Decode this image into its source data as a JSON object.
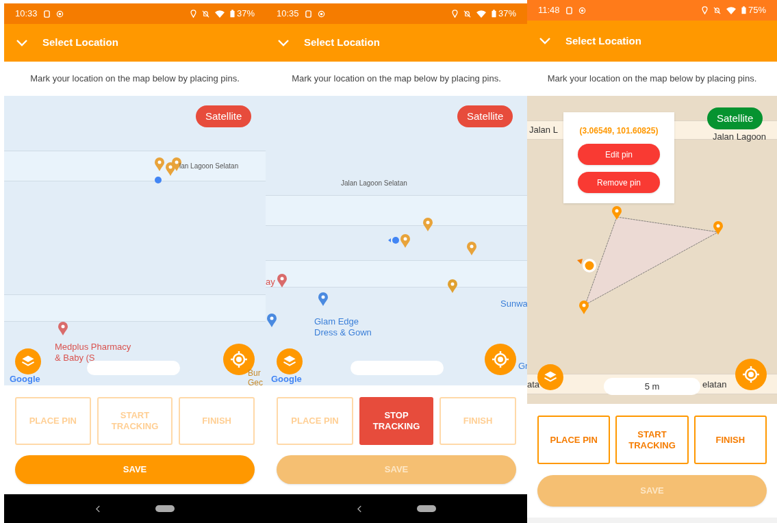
{
  "phones": [
    {
      "status_bar": {
        "time": "10:33",
        "battery": "37%"
      },
      "header": {
        "title": "Select Location"
      },
      "instruction": "Mark your location on the map below by placing pins.",
      "map": {
        "kind": "street",
        "satellite_button": {
          "label": "Satellite",
          "color": "#e74c3c"
        },
        "labels": [
          {
            "text": "lan Lagoon Selatan",
            "kind": "street"
          },
          {
            "text": "Medplus Pharmacy",
            "kind": "poi-red"
          },
          {
            "text": "& Baby (S",
            "kind": "poi-red"
          },
          {
            "text": "Bur",
            "kind": "poi-orange"
          },
          {
            "text": "Gec",
            "kind": "poi-orange"
          }
        ],
        "attribution": "Google"
      },
      "actions": [
        {
          "label": "PLACE PIN",
          "disabled": true,
          "active": false
        },
        {
          "label": "START TRACKING",
          "disabled": true,
          "active": false
        },
        {
          "label": "FINISH",
          "disabled": true,
          "active": false
        }
      ],
      "save": {
        "label": "SAVE",
        "disabled": false
      }
    },
    {
      "status_bar": {
        "time": "10:35",
        "battery": "37%"
      },
      "header": {
        "title": "Select Location"
      },
      "instruction": "Mark your location on the map below by placing pins.",
      "map": {
        "kind": "street",
        "satellite_button": {
          "label": "Satellite",
          "color": "#e74c3c"
        },
        "labels": [
          {
            "text": "Jalan Lagoon Selatan",
            "kind": "street"
          },
          {
            "text": "ay",
            "kind": "poi-red"
          },
          {
            "text": "Glam Edge",
            "kind": "poi-blue"
          },
          {
            "text": "Dress & Gown",
            "kind": "poi-blue"
          },
          {
            "text": "Sunwa",
            "kind": "poi-blue"
          },
          {
            "text": "Gr",
            "kind": "poi-blue"
          }
        ],
        "attribution": "Google"
      },
      "actions": [
        {
          "label": "PLACE PIN",
          "disabled": true,
          "active": false
        },
        {
          "label": "STOP TRACKING",
          "disabled": false,
          "active": true
        },
        {
          "label": "FINISH",
          "disabled": true,
          "active": false
        }
      ],
      "save": {
        "label": "SAVE",
        "disabled": true
      }
    },
    {
      "status_bar": {
        "time": "11:48",
        "battery": "75%"
      },
      "header": {
        "title": "Select Location"
      },
      "instruction": "Mark your location on the map below by placing pins.",
      "map": {
        "kind": "plain",
        "satellite_button": {
          "label": "Satellite",
          "color": "#069330"
        },
        "labels": [
          {
            "text": "Jalan L",
            "kind": "street-dark"
          },
          {
            "text": "Jalan Lagoon",
            "kind": "street-dark"
          },
          {
            "text": "ata",
            "kind": "street-dark"
          },
          {
            "text": "elatan",
            "kind": "street-dark"
          }
        ],
        "scale": "5 m",
        "popup": {
          "coordinates": "(3.06549, 101.60825)",
          "buttons": [
            "Edit pin",
            "Remove pin"
          ]
        }
      },
      "actions": [
        {
          "label": "PLACE PIN",
          "disabled": false,
          "active": false
        },
        {
          "label": "START TRACKING",
          "disabled": false,
          "active": false
        },
        {
          "label": "FINISH",
          "disabled": false,
          "active": false
        }
      ],
      "save": {
        "label": "SAVE",
        "disabled": true
      }
    }
  ]
}
